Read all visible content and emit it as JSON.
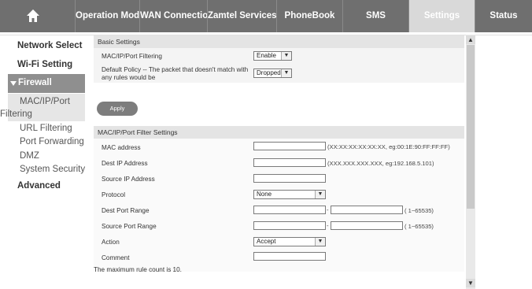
{
  "nav": {
    "tabs": [
      {
        "id": "home",
        "label": ""
      },
      {
        "id": "operation_mode",
        "label": "Operation Mode"
      },
      {
        "id": "wan",
        "label": "WAN Connection"
      },
      {
        "id": "zamtel",
        "label": "Zamtel Services"
      },
      {
        "id": "phonebook",
        "label": "PhoneBook"
      },
      {
        "id": "sms",
        "label": "SMS"
      },
      {
        "id": "settings",
        "label": "Settings"
      },
      {
        "id": "status",
        "label": "Status"
      }
    ],
    "active": "Settings"
  },
  "sidebar": {
    "network_select": "Network Select",
    "wifi_setting": "Wi-Fi Setting",
    "firewall": "Firewall",
    "mac_filter_line1": "MAC/IP/Port",
    "mac_filter_line2": "Filtering",
    "url_filtering": "URL Filtering",
    "port_forwarding": "Port Forwarding",
    "dmz": "DMZ",
    "system_security": "System Security",
    "advanced": "Advanced"
  },
  "basic": {
    "title": "Basic Settings",
    "filtering_label": "MAC/IP/Port Filtering",
    "filtering_value": "Enable",
    "policy_label_line1": "Default Policy -- The packet that doesn't match with",
    "policy_label_line2": "any rules would be",
    "policy_value": "Dropped",
    "apply": "Apply"
  },
  "filter": {
    "title": "MAC/IP/Port Filter Settings",
    "mac_label": "MAC address",
    "mac_value": "",
    "mac_hint": "(XX:XX:XX:XX:XX:XX, eg:00:1E:90:FF:FF:FF)",
    "dest_ip_label": "Dest IP Address",
    "dest_ip_value": "",
    "dest_ip_hint": "(XXX.XXX.XXX.XXX, eg:192.168.5.101)",
    "src_ip_label": "Source IP Address",
    "src_ip_value": "",
    "protocol_label": "Protocol",
    "protocol_value": "None",
    "dest_port_label": "Dest Port Range",
    "dest_port_hint": "( 1~65535)",
    "src_port_label": "Source Port Range",
    "src_port_hint": "( 1~65535)",
    "range_sep": "-",
    "action_label": "Action",
    "action_value": "Accept",
    "comment_label": "Comment",
    "comment_value": "",
    "max_rule_note": "The maximum rule count is 10."
  },
  "icons": {
    "home": "home-icon",
    "dropdown": "chevron-down-icon",
    "scroll_up": "arrow-up-icon",
    "scroll_down": "arrow-down-icon",
    "firewall_expanded": "triangle-down-icon"
  },
  "colors": {
    "nav_bg": "#6f6f6f",
    "nav_active": "#d9d9d9",
    "sidebar_active": "#8f8f8f",
    "section_head": "#e4e4e4",
    "button": "#7d7d7d"
  }
}
